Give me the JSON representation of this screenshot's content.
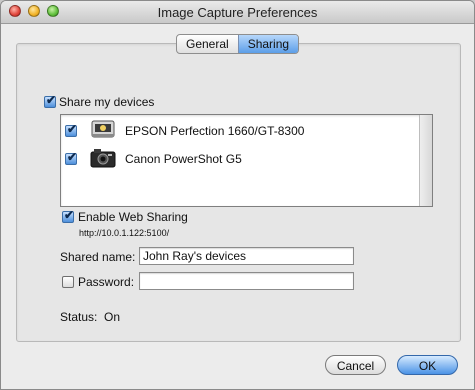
{
  "window": {
    "title": "Image Capture Preferences"
  },
  "tabs": [
    {
      "label": "General",
      "selected": false
    },
    {
      "label": "Sharing",
      "selected": true
    }
  ],
  "share_devices": {
    "label": "Share my devices",
    "checked": true
  },
  "devices": [
    {
      "name": "EPSON Perfection 1660/GT-8300",
      "checked": true,
      "icon": "scanner-icon"
    },
    {
      "name": "Canon PowerShot G5",
      "checked": true,
      "icon": "camera-icon"
    }
  ],
  "web_sharing": {
    "label": "Enable Web Sharing",
    "checked": true,
    "url": "http://10.0.1.122:5100/"
  },
  "shared_name": {
    "label": "Shared name:",
    "value": "John Ray's devices"
  },
  "password": {
    "label": "Password:",
    "checked": false,
    "value": ""
  },
  "status": {
    "label": "Status:",
    "value": "On"
  },
  "buttons": {
    "cancel": "Cancel",
    "ok": "OK"
  }
}
